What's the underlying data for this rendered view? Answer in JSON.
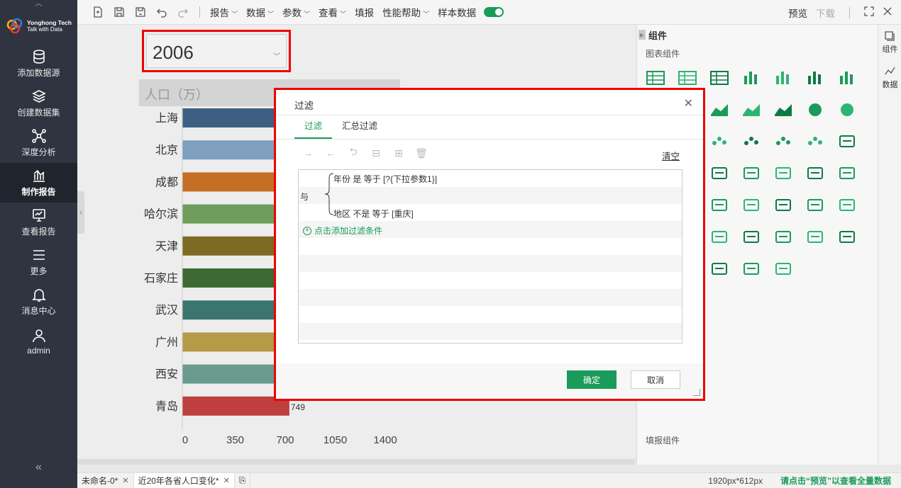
{
  "sidebar": {
    "logo": {
      "brand": "Yonghong Tech",
      "slogan": "Talk with Data"
    },
    "items": [
      {
        "label": "添加数据源",
        "icon": "database-icon"
      },
      {
        "label": "创建数据集",
        "icon": "layers-icon"
      },
      {
        "label": "深度分析",
        "icon": "network-icon"
      },
      {
        "label": "制作报告",
        "icon": "chart-icon",
        "active": true
      },
      {
        "label": "查看报告",
        "icon": "monitor-icon"
      },
      {
        "label": "更多",
        "icon": "menu-icon"
      },
      {
        "label": "消息中心",
        "icon": "bell-icon"
      },
      {
        "label": "admin",
        "icon": "user-icon"
      }
    ],
    "collapse": "«"
  },
  "toolbar": {
    "menus": [
      "报告",
      "数据",
      "参数",
      "查看",
      "填报",
      "性能帮助",
      "样本数据"
    ],
    "preview": "预览",
    "download": "下载"
  },
  "canvas": {
    "year": "2006",
    "chart_title": "人口（万）"
  },
  "chart_data": {
    "type": "bar",
    "orientation": "horizontal",
    "categories": [
      "上海",
      "北京",
      "成都",
      "哈尔滨",
      "天津",
      "石家庄",
      "武汉",
      "广州",
      "西安",
      "青岛"
    ],
    "values": [
      null,
      null,
      null,
      null,
      null,
      null,
      null,
      null,
      null,
      749
    ],
    "value_labels": [
      "",
      "",
      "",
      "",
      "",
      "",
      "",
      "",
      "",
      "749"
    ],
    "xlim": [
      0,
      1400
    ],
    "xticks": [
      "0",
      "350",
      "700",
      "1050",
      "1400"
    ],
    "colors": [
      "#3e5f84",
      "#7f9fc0",
      "#c46f25",
      "#6f9e5c",
      "#7d6a23",
      "#3d6a33",
      "#3b7570",
      "#b59a48",
      "#6b9b8e",
      "#bf3e3e"
    ]
  },
  "right_panel": {
    "title": "组件",
    "chart_section": "图表组件",
    "fill_section": "填报组件",
    "tabs": [
      "组件",
      "数据"
    ],
    "icons": [
      "table-icon",
      "crosstab-icon",
      "freestyle-table-icon",
      "bar-chart-icon",
      "grouped-bar-icon",
      "stacked-bar-icon",
      "percent-bar-icon",
      "line-chart-icon",
      "multi-line-icon",
      "combo-chart-icon",
      "area-chart-icon",
      "stacked-area-icon",
      "pie-chart-icon",
      "donut-chart-icon",
      "ring-chart-icon",
      "scatter-icon",
      "bubble-icon",
      "dot-plot-icon",
      "bubble-cluster-icon",
      "word-cloud-icon",
      "number-icon",
      "funnel-icon",
      "gauge-icon",
      "world-map-icon",
      "region-map-icon",
      "radar-icon",
      "pentagon-icon",
      "step-bar-icon",
      "waffle-icon",
      "heat-grid-icon",
      "treemap-icon",
      "cross-icon",
      "sankey-icon",
      "ring-heat-icon",
      "list-tree-icon",
      "globe-icon",
      "geo-point-icon",
      "candlestick-icon",
      "route-icon",
      "range-slider-icon",
      "calendar-icon",
      "filter-list-icon",
      "tree-select-icon",
      "combo-box-icon",
      "text-box-icon",
      "link-icon",
      "search-box-icon"
    ]
  },
  "statusbar": {
    "tabs": [
      "未命名-0*",
      "近20年各省人口变化*"
    ],
    "size": "1920px*612px",
    "hint": "请点击“预览”以查看全量数据"
  },
  "dialog": {
    "title": "过滤",
    "tabs": [
      "过滤",
      "汇总过滤"
    ],
    "clear": "清空",
    "logic": "与",
    "conditions": [
      "年份 是 等于 [?{下拉参数1}]",
      "地区 不是 等于 [重庆]"
    ],
    "add_condition": "点击添加过滤条件",
    "ok": "确定",
    "cancel": "取消"
  }
}
